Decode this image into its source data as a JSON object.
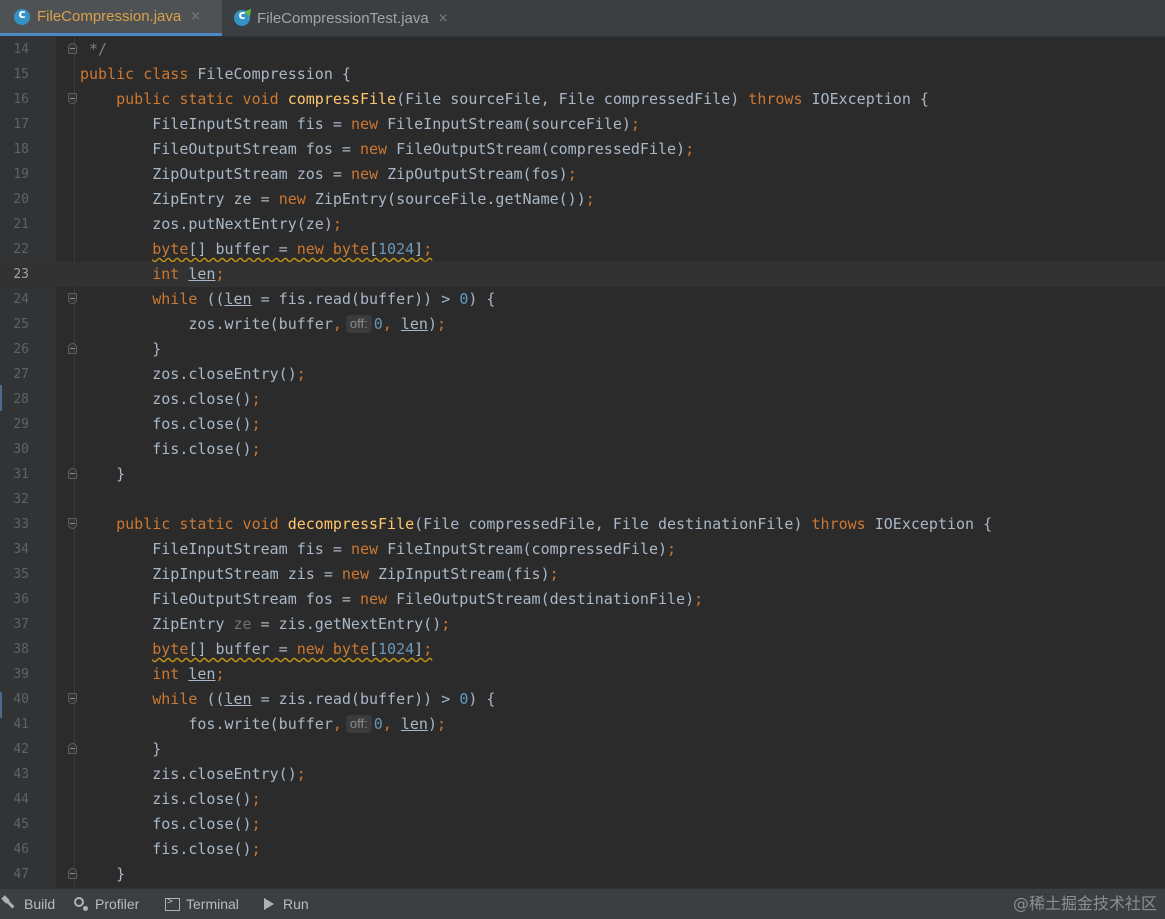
{
  "tabs": [
    {
      "label": "FileCompression.java",
      "active": true,
      "icon": "java-class-icon"
    },
    {
      "label": "FileCompressionTest.java",
      "active": false,
      "icon": "java-test-class-icon"
    }
  ],
  "tab_close_glyph": "×",
  "current_line": 23,
  "code_lines": [
    {
      "n": "14",
      "fold": "close",
      "tokens": [
        [
          "cm",
          " */"
        ]
      ]
    },
    {
      "n": "15",
      "tokens": [
        [
          "kw",
          "public class "
        ],
        [
          "plain",
          "FileCompression {"
        ]
      ]
    },
    {
      "n": "16",
      "fold": "open",
      "tokens": [
        [
          "plain",
          "    "
        ],
        [
          "kw",
          "public static void "
        ],
        [
          "method",
          "compressFile"
        ],
        [
          "plain",
          "(File sourceFile, File compressedFile) "
        ],
        [
          "kw",
          "throws "
        ],
        [
          "plain",
          "IOException {"
        ]
      ]
    },
    {
      "n": "17",
      "tokens": [
        [
          "plain",
          "        FileInputStream fis = "
        ],
        [
          "kw",
          "new "
        ],
        [
          "plain",
          "FileInputStream(sourceFile)"
        ],
        [
          "kw",
          ";"
        ]
      ]
    },
    {
      "n": "18",
      "tokens": [
        [
          "plain",
          "        FileOutputStream fos = "
        ],
        [
          "kw",
          "new "
        ],
        [
          "plain",
          "FileOutputStream(compressedFile)"
        ],
        [
          "kw",
          ";"
        ]
      ]
    },
    {
      "n": "19",
      "tokens": [
        [
          "plain",
          "        ZipOutputStream zos = "
        ],
        [
          "kw",
          "new "
        ],
        [
          "plain",
          "ZipOutputStream(fos)"
        ],
        [
          "kw",
          ";"
        ]
      ]
    },
    {
      "n": "20",
      "tokens": [
        [
          "plain",
          "        ZipEntry ze = "
        ],
        [
          "kw",
          "new "
        ],
        [
          "plain",
          "ZipEntry(sourceFile.getName())"
        ],
        [
          "kw",
          ";"
        ]
      ]
    },
    {
      "n": "21",
      "tokens": [
        [
          "plain",
          "        zos.putNextEntry(ze)"
        ],
        [
          "kw",
          ";"
        ]
      ]
    },
    {
      "n": "22",
      "tokens": [
        [
          "plain",
          "        "
        ],
        [
          "kw-warn",
          "byte"
        ],
        [
          "plain-warn",
          "[] buffer = "
        ],
        [
          "kw-warn",
          "new byte"
        ],
        [
          "plain-warn",
          "["
        ],
        [
          "num-warn",
          "1024"
        ],
        [
          "plain-warn",
          "]"
        ],
        [
          "kw-warn",
          ";"
        ]
      ]
    },
    {
      "n": "23",
      "tokens": [
        [
          "plain",
          "        "
        ],
        [
          "kw",
          "int "
        ],
        [
          "plain-ul",
          "len"
        ],
        [
          "kw",
          ";"
        ]
      ]
    },
    {
      "n": "24",
      "fold": "open",
      "tokens": [
        [
          "plain",
          "        "
        ],
        [
          "kw",
          "while "
        ],
        [
          "plain",
          "(("
        ],
        [
          "plain-ul",
          "len"
        ],
        [
          "plain",
          " = fis.read(buffer)) > "
        ],
        [
          "num",
          "0"
        ],
        [
          "plain",
          ") {"
        ]
      ]
    },
    {
      "n": "25",
      "tokens": [
        [
          "plain",
          "            zos.write(buffer"
        ],
        [
          "kw",
          ","
        ],
        [
          "hint",
          "off:"
        ],
        [
          "num",
          "0"
        ],
        [
          "kw",
          ", "
        ],
        [
          "plain-ul",
          "len"
        ],
        [
          "plain",
          ")"
        ],
        [
          "kw",
          ";"
        ]
      ]
    },
    {
      "n": "26",
      "fold": "close",
      "tokens": [
        [
          "plain",
          "        }"
        ]
      ]
    },
    {
      "n": "27",
      "tokens": [
        [
          "plain",
          "        zos.closeEntry()"
        ],
        [
          "kw",
          ";"
        ]
      ]
    },
    {
      "n": "28",
      "tokens": [
        [
          "plain",
          "        zos.close()"
        ],
        [
          "kw",
          ";"
        ]
      ]
    },
    {
      "n": "29",
      "tokens": [
        [
          "plain",
          "        fos.close()"
        ],
        [
          "kw",
          ";"
        ]
      ]
    },
    {
      "n": "30",
      "tokens": [
        [
          "plain",
          "        fis.close()"
        ],
        [
          "kw",
          ";"
        ]
      ]
    },
    {
      "n": "31",
      "fold": "close",
      "tokens": [
        [
          "plain",
          "    }"
        ]
      ]
    },
    {
      "n": "32",
      "tokens": []
    },
    {
      "n": "33",
      "fold": "open",
      "tokens": [
        [
          "plain",
          "    "
        ],
        [
          "kw",
          "public static void "
        ],
        [
          "method",
          "decompressFile"
        ],
        [
          "plain",
          "(File compressedFile, File destinationFile) "
        ],
        [
          "kw",
          "throws "
        ],
        [
          "plain",
          "IOException {"
        ]
      ]
    },
    {
      "n": "34",
      "tokens": [
        [
          "plain",
          "        FileInputStream fis = "
        ],
        [
          "kw",
          "new "
        ],
        [
          "plain",
          "FileInputStream(compressedFile)"
        ],
        [
          "kw",
          ";"
        ]
      ]
    },
    {
      "n": "35",
      "tokens": [
        [
          "plain",
          "        ZipInputStream zis = "
        ],
        [
          "kw",
          "new "
        ],
        [
          "plain",
          "ZipInputStream(fis)"
        ],
        [
          "kw",
          ";"
        ]
      ]
    },
    {
      "n": "36",
      "tokens": [
        [
          "plain",
          "        FileOutputStream fos = "
        ],
        [
          "kw",
          "new "
        ],
        [
          "plain",
          "FileOutputStream(destinationFile)"
        ],
        [
          "kw",
          ";"
        ]
      ]
    },
    {
      "n": "37",
      "tokens": [
        [
          "plain",
          "        ZipEntry "
        ],
        [
          "unused",
          "ze"
        ],
        [
          "plain",
          " = zis.getNextEntry()"
        ],
        [
          "kw",
          ";"
        ]
      ]
    },
    {
      "n": "38",
      "tokens": [
        [
          "plain",
          "        "
        ],
        [
          "kw-warn",
          "byte"
        ],
        [
          "plain-warn",
          "[] buffer = "
        ],
        [
          "kw-warn",
          "new byte"
        ],
        [
          "plain-warn",
          "["
        ],
        [
          "num-warn",
          "1024"
        ],
        [
          "plain-warn",
          "]"
        ],
        [
          "kw-warn",
          ";"
        ]
      ]
    },
    {
      "n": "39",
      "tokens": [
        [
          "plain",
          "        "
        ],
        [
          "kw",
          "int "
        ],
        [
          "plain-ul",
          "len"
        ],
        [
          "kw",
          ";"
        ]
      ]
    },
    {
      "n": "40",
      "fold": "open",
      "tokens": [
        [
          "plain",
          "        "
        ],
        [
          "kw",
          "while "
        ],
        [
          "plain",
          "(("
        ],
        [
          "plain-ul",
          "len"
        ],
        [
          "plain",
          " = zis.read(buffer)) > "
        ],
        [
          "num",
          "0"
        ],
        [
          "plain",
          ") {"
        ]
      ]
    },
    {
      "n": "41",
      "tokens": [
        [
          "plain",
          "            fos.write(buffer"
        ],
        [
          "kw",
          ","
        ],
        [
          "hint",
          "off:"
        ],
        [
          "num",
          "0"
        ],
        [
          "kw",
          ", "
        ],
        [
          "plain-ul",
          "len"
        ],
        [
          "plain",
          ")"
        ],
        [
          "kw",
          ";"
        ]
      ]
    },
    {
      "n": "42",
      "fold": "close",
      "tokens": [
        [
          "plain",
          "        }"
        ]
      ]
    },
    {
      "n": "43",
      "tokens": [
        [
          "plain",
          "        zis.closeEntry()"
        ],
        [
          "kw",
          ";"
        ]
      ]
    },
    {
      "n": "44",
      "tokens": [
        [
          "plain",
          "        zis.close()"
        ],
        [
          "kw",
          ";"
        ]
      ]
    },
    {
      "n": "45",
      "tokens": [
        [
          "plain",
          "        fos.close()"
        ],
        [
          "kw",
          ";"
        ]
      ]
    },
    {
      "n": "46",
      "tokens": [
        [
          "plain",
          "        fis.close()"
        ],
        [
          "kw",
          ";"
        ]
      ]
    },
    {
      "n": "47",
      "fold": "close",
      "tokens": [
        [
          "plain",
          "    }"
        ]
      ]
    }
  ],
  "bottom_tools": [
    {
      "label": "Build",
      "icon": "hammer-icon"
    },
    {
      "label": "Profiler",
      "icon": "profiler-icon"
    },
    {
      "label": "Terminal",
      "icon": "terminal-icon"
    },
    {
      "label": "Run",
      "icon": "run-icon"
    }
  ],
  "watermark": "@稀土掘金技术社区",
  "colors": {
    "background": "#2b2b2b",
    "keyword": "#cc7832",
    "text": "#a9b7c6",
    "method": "#ffc66d",
    "number": "#6897bb",
    "comment": "#808080",
    "active_tab_text": "#d8a14a",
    "active_tab_underline": "#4a88c7",
    "warning_underline": "#be9117"
  }
}
